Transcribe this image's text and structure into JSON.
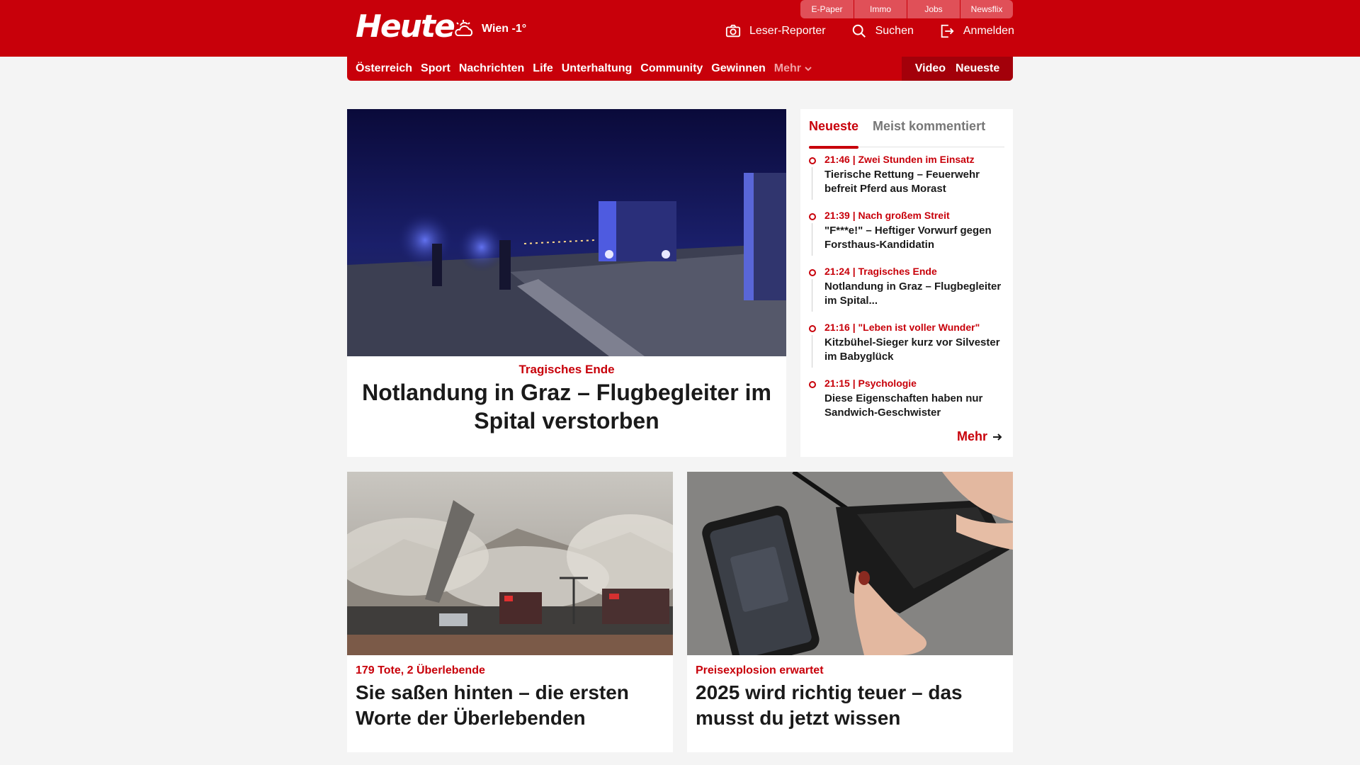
{
  "header": {
    "logo": "Heute",
    "weather_label": "Wien -1°",
    "service_tabs": [
      "E-Paper",
      "Immo",
      "Jobs",
      "Newsflix"
    ],
    "actions": {
      "reporter": "Leser-Reporter",
      "search": "Suchen",
      "login": "Anmelden"
    }
  },
  "nav": {
    "items": [
      "Österreich",
      "Sport",
      "Nachrichten",
      "Life",
      "Unterhaltung",
      "Community",
      "Gewinnen"
    ],
    "more_label": "Mehr",
    "right_items": [
      "Video",
      "Neueste"
    ]
  },
  "hero": {
    "kicker": "Tragisches Ende",
    "title": "Notlandung in Graz – Flugbegleiter im Spital verstorben"
  },
  "sidebar": {
    "tabs": [
      "Neueste",
      "Meist kommentiert"
    ],
    "items": [
      {
        "meta": "21:46 | Zwei Stunden im Einsatz",
        "title": "Tierische Rettung – Feuerwehr befreit Pferd aus Morast"
      },
      {
        "meta": "21:39 | Nach großem Streit",
        "title": "\"F***e!\" – Heftiger Vorwurf gegen Forsthaus-Kandidatin"
      },
      {
        "meta": "21:24 | Tragisches Ende",
        "title": "Notlandung in Graz – Flugbegleiter im Spital..."
      },
      {
        "meta": "21:16 | \"Leben ist voller Wunder\"",
        "title": "Kitzbühel-Sieger kurz vor Silvester im Babyglück"
      },
      {
        "meta": "21:15 | Psychologie",
        "title": "Diese Eigenschaften haben nur Sandwich-Geschwister"
      }
    ],
    "more_label": "Mehr"
  },
  "cards": [
    {
      "kicker": "179 Tote, 2 Überlebende",
      "title": "Sie saßen hinten – die ersten Worte der Überlebenden"
    },
    {
      "kicker": "Preisexplosion erwartet",
      "title": "2025 wird richtig teuer – das musst du jetzt wissen"
    }
  ],
  "colors": {
    "brand_red": "#c8000a",
    "page_bg": "#f4f4f4"
  }
}
